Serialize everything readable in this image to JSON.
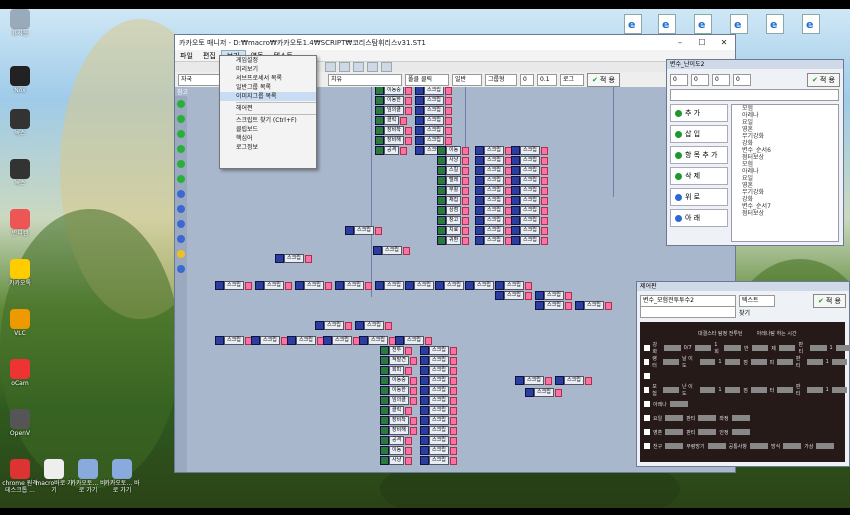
{
  "desktop": {
    "icons": [
      {
        "label": "휴지통"
      },
      {
        "label": "Nox"
      },
      {
        "label": "녹스"
      },
      {
        "label": "녹스"
      },
      {
        "label": "반디캠"
      },
      {
        "label": "카카오톡"
      },
      {
        "label": "VLC"
      },
      {
        "label": "oCam"
      },
      {
        "label": "OpenV"
      },
      {
        "label": "크롬"
      }
    ],
    "bottom_icons": [
      {
        "label": "chrome 원격 데스크톱 ..."
      },
      {
        "label": "macro바로 가기"
      },
      {
        "label": "카카오토... 바로 가기"
      },
      {
        "label": "카카오토... 바로 가기"
      }
    ],
    "ie_icons": 6
  },
  "window": {
    "title": "카카오토 매니저 - D:₩macro₩카카오토1.4₩SCRIPT₩코리스탐휘리스v31.ST1",
    "menus": [
      "파일",
      "편집",
      "보기",
      "연동",
      "텍스트"
    ],
    "active_menu": "보기",
    "dropdown_items": [
      "게임설정",
      "미리보기",
      "서브프로세서 목록",
      "일반그룹 목록",
      "이미지그룹 목록",
      "헤어쪈",
      "스크립트 찾기 (Ctrl+F)",
      "클립보드",
      "핵심어",
      "로그정보"
    ],
    "dropdown_selected": "이미지그룹 목록",
    "prop_fields": [
      "자국",
      "치유",
      "폴클 클릭",
      "일반",
      "그룹형",
      "무관",
      "0",
      "0.1",
      "로그"
    ],
    "apply_label": "적 용",
    "canvas_tab": "참고",
    "node_label": "스크립",
    "node_labels_other": [
      "이동중",
      "이동한",
      "임의클",
      "클릭",
      "장비착",
      "장비해",
      "공격",
      "이동",
      "사냥",
      "스킬",
      "텔레",
      "부활",
      "채집",
      "상점",
      "창고",
      "치료",
      "귀환",
      "전투",
      "적발견",
      "회피"
    ]
  },
  "var_panel": {
    "title": "변수_난이도2",
    "controls": [
      "0",
      "0",
      "0",
      "0"
    ],
    "apply_label": "적 용",
    "commands": [
      {
        "label": "추 가",
        "color": "#1a9a2a"
      },
      {
        "label": "삽 입",
        "color": "#1a9a2a"
      },
      {
        "label": "항 목 추 가",
        "color": "#1a9a2a"
      },
      {
        "label": "삭 제",
        "color": "#1a9a2a"
      },
      {
        "label": "위 로",
        "color": "#2a6ad0"
      },
      {
        "label": "아 래",
        "color": "#2a6ad0"
      }
    ],
    "list": [
      "모험",
      "아레나",
      "요일",
      "영혼",
      "무기강화",
      "강화",
      "변수_순서6",
      "점터보상",
      "모험",
      "아레나",
      "요일",
      "영혼",
      "무기강화",
      "강화",
      "변수_순서7",
      "점터보상"
    ]
  },
  "edit_panel": {
    "title": "제어판",
    "name_field": "변수_모험전투투수2",
    "type_field": "텍스트",
    "sub_field": "찾기",
    "apply_label": "적 용",
    "preview_header": [
      "대결스타 탐정 전투턴",
      "아레나탐 하는 시간"
    ],
    "preview_rows": [
      [
        "강화",
        "0/7",
        "1회",
        "반",
        "제",
        "판티",
        "1"
      ],
      [
        "랭터",
        "날 이 도",
        "1",
        "점",
        "피",
        "판티",
        "1"
      ],
      [
        "",
        "",
        "",
        "",
        "",
        "",
        ""
      ],
      [
        "모험",
        "난 이 도",
        "1",
        "점",
        "터",
        "판티",
        "1"
      ],
      [
        "아레나",
        "",
        "",
        "",
        "",
        "",
        ""
      ],
      [
        "요일",
        "판티",
        "",
        "좌정",
        "",
        "",
        ""
      ],
      [
        "영혼",
        "판티",
        "",
        "안정",
        "",
        "",
        ""
      ],
      [
        "천구",
        "무령방기",
        "",
        "공통사항",
        "방식",
        "가상",
        ""
      ]
    ]
  }
}
